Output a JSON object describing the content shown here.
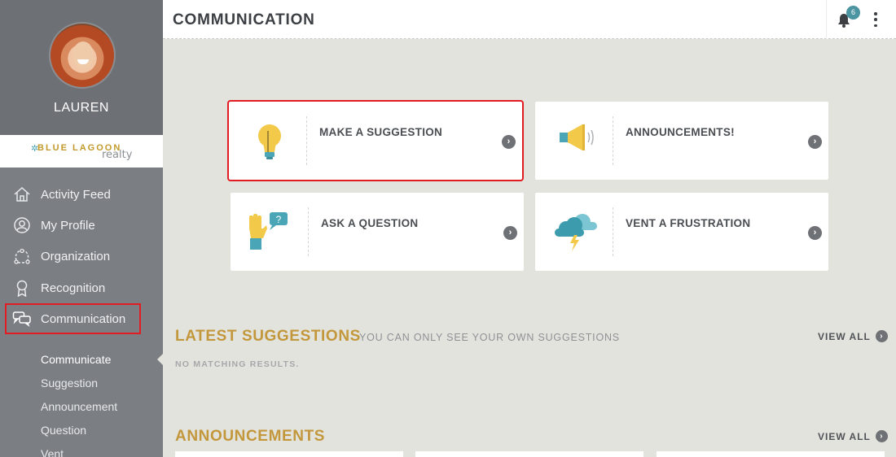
{
  "user": {
    "name": "LAUREN"
  },
  "brand": {
    "name_top": "BLUE LAGOON",
    "name_bottom": "realty"
  },
  "nav": {
    "items": [
      {
        "label": "Activity Feed",
        "icon": "home-icon"
      },
      {
        "label": "My Profile",
        "icon": "user-icon"
      },
      {
        "label": "Organization",
        "icon": "network-icon"
      },
      {
        "label": "Recognition",
        "icon": "ribbon-icon"
      },
      {
        "label": "Communication",
        "icon": "chat-bubbles-icon"
      }
    ],
    "sub_items": [
      "Communicate",
      "Suggestion",
      "Announcement",
      "Question",
      "Vent"
    ]
  },
  "header": {
    "title": "COMMUNICATION",
    "notifications_count": "6"
  },
  "cards": [
    {
      "label": "MAKE A SUGGESTION",
      "icon": "lightbulb-icon"
    },
    {
      "label": "ANNOUNCEMENTS!",
      "icon": "megaphone-icon"
    },
    {
      "label": "ASK A QUESTION",
      "icon": "raised-hand-question-icon"
    },
    {
      "label": "VENT A FRUSTRATION",
      "icon": "storm-cloud-icon"
    }
  ],
  "latest_suggestions": {
    "title": "LATEST SUGGESTIONS",
    "note": "YOU CAN ONLY SEE YOUR OWN SUGGESTIONS",
    "view_all": "VIEW ALL",
    "empty": "NO MATCHING RESULTS."
  },
  "announcements": {
    "title": "ANNOUNCEMENTS",
    "view_all": "VIEW ALL"
  },
  "colors": {
    "accent_gold": "#c3973b",
    "sidebar": "#7b7f84",
    "highlight": "#e31b23",
    "badge": "#4b94a2"
  }
}
